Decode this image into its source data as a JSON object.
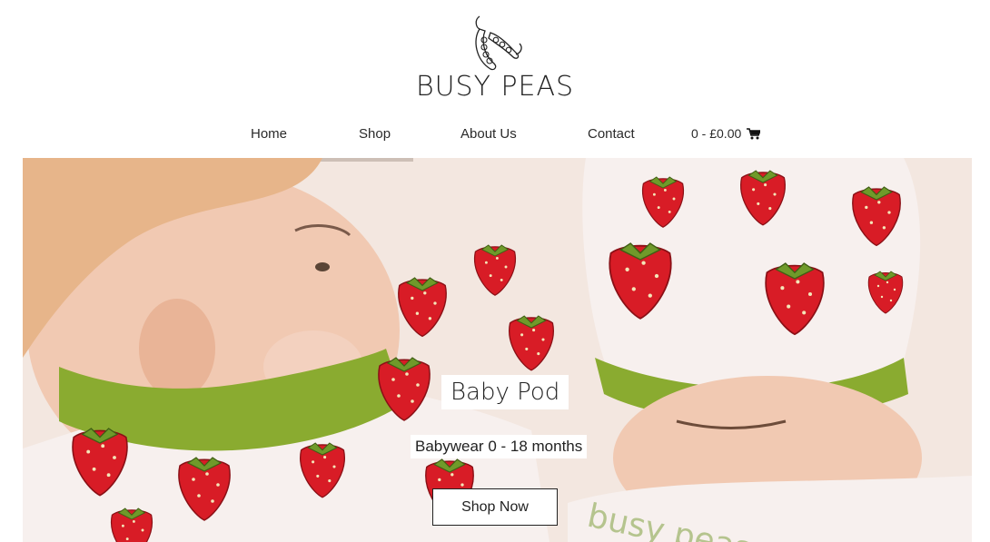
{
  "brand": {
    "name": "BUSY PEAS",
    "logo_icon": "peapod-icon"
  },
  "nav": {
    "items": [
      {
        "label": "Home"
      },
      {
        "label": "Shop"
      },
      {
        "label": "About Us"
      },
      {
        "label": "Contact"
      }
    ],
    "cart": {
      "label": "0 - £0.00",
      "icon": "cart-icon"
    }
  },
  "hero": {
    "title": "Baby Pod",
    "subtitle": "Babywear 0 - 18 months",
    "button_label": "Shop Now",
    "print_text": "busy peas",
    "colors": {
      "strawberry": "#d81c26",
      "green_trim": "#8aab30",
      "fabric": "#f7f0ee"
    }
  }
}
